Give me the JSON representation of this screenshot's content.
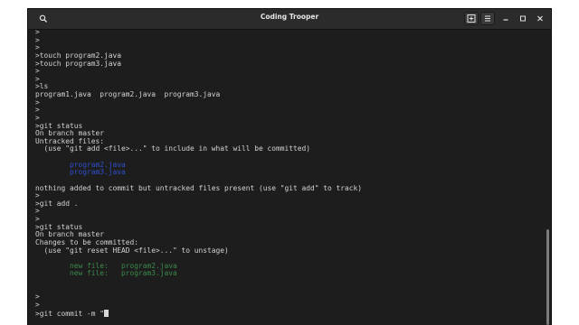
{
  "window": {
    "title": "Coding Trooper",
    "icons": [
      "search-icon",
      "new-tab-icon",
      "menu-icon",
      "minimize-icon",
      "maximize-icon",
      "close-icon"
    ]
  },
  "terminal": {
    "lines": [
      {
        "text": ">",
        "style": "normal"
      },
      {
        "text": ">",
        "style": "normal"
      },
      {
        "text": ">",
        "style": "normal"
      },
      {
        "text": ">touch program2.java",
        "style": "normal"
      },
      {
        "text": ">touch program3.java",
        "style": "normal"
      },
      {
        "text": ">",
        "style": "normal"
      },
      {
        "text": ">",
        "style": "normal"
      },
      {
        "text": ">ls",
        "style": "normal"
      },
      {
        "text": "program1.java  program2.java  program3.java",
        "style": "normal"
      },
      {
        "text": ">",
        "style": "normal"
      },
      {
        "text": ">",
        "style": "normal"
      },
      {
        "text": ">",
        "style": "normal"
      },
      {
        "text": ">git status",
        "style": "normal"
      },
      {
        "text": "On branch master",
        "style": "normal"
      },
      {
        "text": "Untracked files:",
        "style": "normal"
      },
      {
        "text": "  (use \"git add <file>...\" to include in what will be committed)",
        "style": "normal"
      },
      {
        "text": "",
        "style": "normal"
      },
      {
        "text": "        program2.java",
        "style": "blue"
      },
      {
        "text": "        program3.java",
        "style": "blue"
      },
      {
        "text": "",
        "style": "normal"
      },
      {
        "text": "nothing added to commit but untracked files present (use \"git add\" to track)",
        "style": "normal"
      },
      {
        "text": ">",
        "style": "normal"
      },
      {
        "text": ">git add .",
        "style": "normal"
      },
      {
        "text": ">",
        "style": "normal"
      },
      {
        "text": ">",
        "style": "normal"
      },
      {
        "text": ">git status",
        "style": "normal"
      },
      {
        "text": "On branch master",
        "style": "normal"
      },
      {
        "text": "Changes to be committed:",
        "style": "normal"
      },
      {
        "text": "  (use \"git reset HEAD <file>...\" to unstage)",
        "style": "normal"
      },
      {
        "text": "",
        "style": "normal"
      },
      {
        "text": "        new file:   program2.java",
        "style": "green"
      },
      {
        "text": "        new file:   program3.java",
        "style": "green"
      },
      {
        "text": "",
        "style": "normal"
      },
      {
        "text": "",
        "style": "normal"
      },
      {
        "text": ">",
        "style": "normal"
      },
      {
        "text": ">",
        "style": "normal"
      },
      {
        "text": ">git commit -m \"",
        "style": "normal",
        "cursor": true
      }
    ]
  },
  "colors": {
    "background": "#1d1d1d",
    "text": "#d3d3d3",
    "untracked": "#2e4fd0",
    "staged": "#3a8a4a"
  }
}
